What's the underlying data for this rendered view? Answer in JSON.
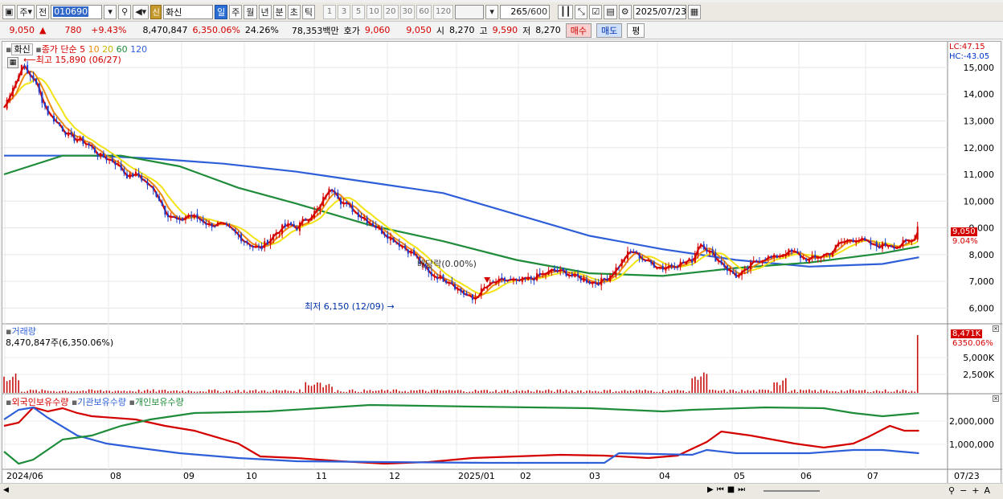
{
  "toolbar": {
    "period_items": [
      "주",
      "전"
    ],
    "code": "010690",
    "name_badge": "신",
    "stock_name": "화신",
    "tf_items": [
      "일",
      "주",
      "월",
      "년",
      "분",
      "초",
      "틱"
    ],
    "tf_selected": "일",
    "num_items": [
      "1",
      "3",
      "5",
      "10",
      "20",
      "30",
      "60",
      "120"
    ],
    "count_value": "265",
    "count_total": "/600",
    "date": "2025/07/23"
  },
  "quote": {
    "price": "9,050",
    "arrow": "▲",
    "change": "780",
    "change_pct": "+9.43%",
    "volume": "8,470,847",
    "volume_pct": "6,350.06%",
    "turnover": "24.26%",
    "amount": "78,353백만",
    "ask_label": "호가",
    "ask": "9,060",
    "bid": "9,050",
    "open_label": "시",
    "open": "8,270",
    "high_label": "고",
    "high": "9,590",
    "low_label": "저",
    "low": "8,270",
    "buy_label": "매수",
    "sell_label": "매도",
    "eval_label": "평"
  },
  "price_panel": {
    "title": "화신",
    "ma_title": "종가 단순",
    "ma_periods": [
      "5",
      "10",
      "20",
      "60",
      "120"
    ],
    "ma_colors": [
      "#d40000",
      "#ee8a10",
      "#f2e414",
      "#1e8c3a",
      "#2e5fd8"
    ],
    "high_note": "최고 15,890 (06/27)",
    "low_note": "최저 6,150 (12/09)",
    "ex_note": "배당락(0.00%)",
    "lc": "LC:47.15",
    "hc": "HC:-43.05",
    "last_price": "9,050",
    "last_pct": "9.04%",
    "y_ticks": [
      "15,000",
      "14,000",
      "13,000",
      "12,000",
      "11,000",
      "10,000",
      "9,000",
      "8,000",
      "7,000",
      "6,000"
    ]
  },
  "volume_panel": {
    "title": "거래량",
    "value": "8,470,847주(6,350.06%)",
    "last": "8,471K",
    "last_pct": "6350.06%",
    "y_ticks": [
      "5,000K",
      "2,500K"
    ]
  },
  "holdings_panel": {
    "series": [
      "외국인보유수량",
      "기관보유수량",
      "개인보유수량"
    ],
    "colors": [
      "#d40000",
      "#2e5fd8",
      "#1e8c3a"
    ],
    "y_ticks": [
      "2,000,000",
      "1,000,000"
    ]
  },
  "x_axis": {
    "labels": [
      "2024/06",
      "08",
      "09",
      "10",
      "11",
      "12",
      "2025/01",
      "02",
      "03",
      "04",
      "05",
      "06",
      "07"
    ],
    "right_label": "07/23"
  },
  "chart_data": {
    "type": "line",
    "price_y_range": [
      5500,
      15900
    ],
    "close_points": [
      [
        0,
        13500
      ],
      [
        5,
        14200
      ],
      [
        10,
        14700
      ],
      [
        12,
        15200
      ],
      [
        15,
        14800
      ],
      [
        20,
        14600
      ],
      [
        25,
        13900
      ],
      [
        30,
        13300
      ],
      [
        35,
        13000
      ],
      [
        40,
        12700
      ],
      [
        45,
        12400
      ],
      [
        50,
        12300
      ],
      [
        55,
        12200
      ],
      [
        60,
        12000
      ],
      [
        65,
        11700
      ],
      [
        70,
        11600
      ],
      [
        75,
        11500
      ],
      [
        80,
        11200
      ],
      [
        85,
        10900
      ],
      [
        90,
        11000
      ],
      [
        95,
        10800
      ],
      [
        100,
        10500
      ],
      [
        105,
        10200
      ],
      [
        110,
        9600
      ],
      [
        115,
        9400
      ],
      [
        120,
        9200
      ],
      [
        125,
        9500
      ],
      [
        130,
        9400
      ],
      [
        135,
        9300
      ],
      [
        140,
        9100
      ],
      [
        145,
        9150
      ],
      [
        150,
        9050
      ],
      [
        155,
        8900
      ],
      [
        160,
        8700
      ],
      [
        165,
        8500
      ],
      [
        170,
        8300
      ],
      [
        175,
        8200
      ],
      [
        180,
        8500
      ],
      [
        185,
        8800
      ],
      [
        190,
        9000
      ],
      [
        195,
        9100
      ],
      [
        200,
        9000
      ],
      [
        205,
        9300
      ],
      [
        210,
        9500
      ],
      [
        215,
        9700
      ],
      [
        220,
        10300
      ],
      [
        225,
        10500
      ],
      [
        230,
        10000
      ],
      [
        235,
        9800
      ],
      [
        240,
        9600
      ],
      [
        245,
        9400
      ],
      [
        250,
        9200
      ],
      [
        255,
        9000
      ],
      [
        260,
        8800
      ],
      [
        265,
        8600
      ],
      [
        270,
        8400
      ],
      [
        275,
        8200
      ],
      [
        280,
        8000
      ],
      [
        285,
        7600
      ],
      [
        290,
        7300
      ],
      [
        295,
        7200
      ],
      [
        300,
        7100
      ],
      [
        305,
        7000
      ],
      [
        310,
        6700
      ],
      [
        315,
        6500
      ],
      [
        320,
        6300
      ],
      [
        325,
        6600
      ],
      [
        330,
        6800
      ],
      [
        335,
        6950
      ],
      [
        340,
        7000
      ],
      [
        345,
        7050
      ],
      [
        350,
        6950
      ],
      [
        355,
        7050
      ],
      [
        360,
        7100
      ],
      [
        365,
        7200
      ],
      [
        370,
        7300
      ],
      [
        375,
        7400
      ],
      [
        380,
        7350
      ],
      [
        385,
        7300
      ],
      [
        390,
        7150
      ],
      [
        395,
        7100
      ],
      [
        400,
        7000
      ],
      [
        405,
        6950
      ],
      [
        410,
        7050
      ],
      [
        415,
        7300
      ],
      [
        420,
        7600
      ],
      [
        425,
        8000
      ],
      [
        430,
        8100
      ],
      [
        435,
        7900
      ],
      [
        440,
        7700
      ],
      [
        445,
        7600
      ],
      [
        450,
        7500
      ],
      [
        455,
        7600
      ],
      [
        460,
        7650
      ],
      [
        465,
        7700
      ],
      [
        470,
        7800
      ],
      [
        475,
        8500
      ],
      [
        480,
        8200
      ],
      [
        485,
        7900
      ],
      [
        490,
        7700
      ],
      [
        495,
        7400
      ],
      [
        500,
        7200
      ],
      [
        505,
        7300
      ],
      [
        510,
        7600
      ],
      [
        515,
        7800
      ],
      [
        520,
        7900
      ],
      [
        525,
        7850
      ],
      [
        530,
        8000
      ],
      [
        535,
        8100
      ],
      [
        540,
        8050
      ],
      [
        545,
        7900
      ],
      [
        550,
        7800
      ],
      [
        555,
        7900
      ],
      [
        560,
        8000
      ],
      [
        565,
        8100
      ],
      [
        570,
        8400
      ],
      [
        575,
        8500
      ],
      [
        580,
        8600
      ],
      [
        585,
        8550
      ],
      [
        590,
        8400
      ],
      [
        595,
        8300
      ],
      [
        600,
        8350
      ],
      [
        605,
        8400
      ],
      [
        610,
        8300
      ],
      [
        615,
        8450
      ],
      [
        620,
        8500
      ],
      [
        625,
        9050
      ]
    ],
    "ma120_points": [
      [
        0,
        11700
      ],
      [
        60,
        11700
      ],
      [
        100,
        11600
      ],
      [
        150,
        11400
      ],
      [
        200,
        11100
      ],
      [
        250,
        10700
      ],
      [
        300,
        10300
      ],
      [
        350,
        9500
      ],
      [
        400,
        8700
      ],
      [
        450,
        8200
      ],
      [
        500,
        7800
      ],
      [
        550,
        7550
      ],
      [
        600,
        7650
      ],
      [
        625,
        7900
      ]
    ],
    "ma60_points": [
      [
        0,
        11000
      ],
      [
        40,
        11700
      ],
      [
        80,
        11700
      ],
      [
        120,
        11300
      ],
      [
        160,
        10500
      ],
      [
        200,
        9900
      ],
      [
        250,
        9100
      ],
      [
        300,
        8500
      ],
      [
        350,
        7800
      ],
      [
        400,
        7300
      ],
      [
        450,
        7200
      ],
      [
        500,
        7500
      ],
      [
        550,
        7700
      ],
      [
        600,
        8050
      ],
      [
        625,
        8300
      ]
    ]
  }
}
